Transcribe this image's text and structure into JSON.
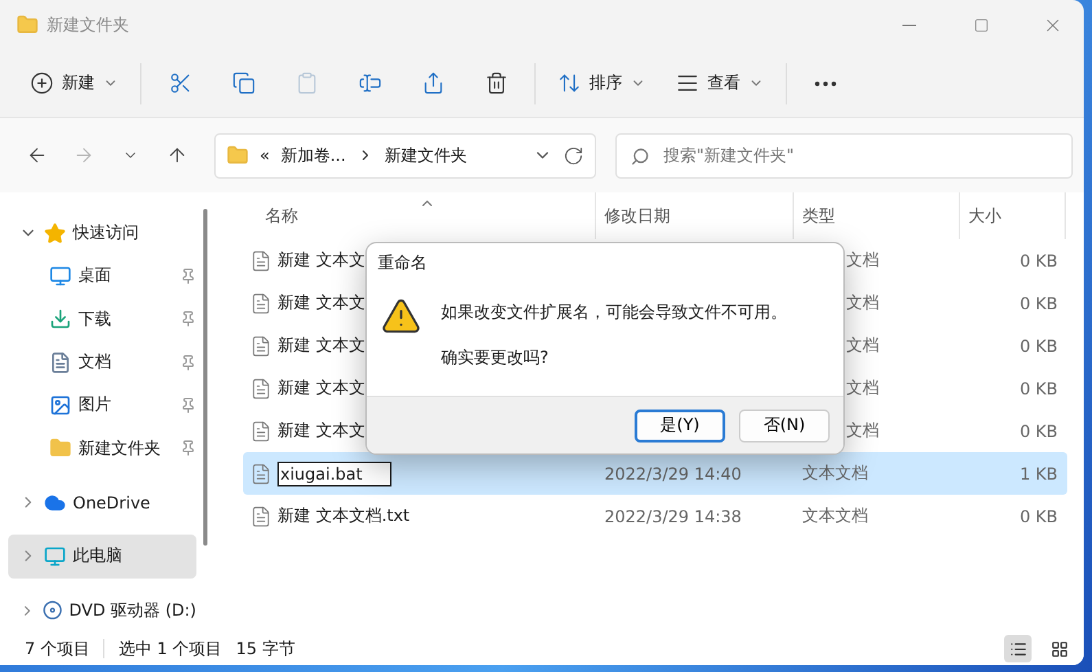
{
  "window": {
    "title": "新建文件夹"
  },
  "toolbar": [
    {
      "kind": "new",
      "label": "新建",
      "dropdown": true,
      "disabled": false
    },
    {
      "kind": "cut",
      "disabled": false
    },
    {
      "kind": "copy",
      "disabled": false
    },
    {
      "kind": "paste",
      "disabled": true
    },
    {
      "kind": "rename",
      "disabled": false
    },
    {
      "kind": "share",
      "disabled": false
    },
    {
      "kind": "delete",
      "disabled": false
    },
    {
      "kind": "sort",
      "label": "排序",
      "dropdown": true,
      "disabled": false
    },
    {
      "kind": "view",
      "label": "查看",
      "dropdown": true,
      "disabled": false
    },
    {
      "kind": "more",
      "disabled": false
    }
  ],
  "navigation": [
    {
      "kind": "back",
      "disabled": false
    },
    {
      "kind": "forward",
      "disabled": true
    },
    {
      "kind": "recent",
      "disabled": false
    },
    {
      "kind": "up",
      "disabled": false
    }
  ],
  "address": {
    "overflow": "«",
    "segments": [
      "新加卷...",
      "新建文件夹"
    ]
  },
  "search": {
    "placeholder": "搜索\"新建文件夹\""
  },
  "sidebar": {
    "items": [
      {
        "label": "快速访问",
        "kind": "star",
        "expanded": true,
        "selected": false,
        "children": [
          {
            "label": "桌面",
            "kind": "desktop",
            "pinned": true,
            "selected": false
          },
          {
            "label": "下载",
            "kind": "download",
            "pinned": true,
            "selected": false
          },
          {
            "label": "文档",
            "kind": "documents",
            "pinned": true,
            "selected": false
          },
          {
            "label": "图片",
            "kind": "pictures",
            "pinned": true,
            "selected": false
          },
          {
            "label": "新建文件夹",
            "kind": "folder",
            "pinned": true,
            "selected": false
          }
        ]
      },
      {
        "label": "OneDrive",
        "kind": "cloud",
        "expanded": false,
        "selected": false
      },
      {
        "label": "此电脑",
        "kind": "pc",
        "expanded": false,
        "selected": true
      },
      {
        "label": "DVD 驱动器 (D:)",
        "kind": "dvd",
        "expanded": false,
        "selected": false
      }
    ]
  },
  "table": {
    "columns": [
      {
        "label": "名称",
        "sorted": true
      },
      {
        "label": "修改日期",
        "sorted": false
      },
      {
        "label": "类型",
        "sorted": false
      },
      {
        "label": "大小",
        "sorted": false
      }
    ],
    "rows": [
      {
        "name": "新建 文本文",
        "type": "文档",
        "size": "0 KB",
        "selected": false,
        "editing": false
      },
      {
        "name": "新建 文本文",
        "type": "文档",
        "size": "0 KB",
        "selected": false,
        "editing": false
      },
      {
        "name": "新建 文本文",
        "type": "文档",
        "size": "0 KB",
        "selected": false,
        "editing": false
      },
      {
        "name": "新建 文本文",
        "type": "文档",
        "size": "0 KB",
        "selected": false,
        "editing": false
      },
      {
        "name": "新建 文本文",
        "type": "文档",
        "size": "0 KB",
        "selected": false,
        "editing": false
      },
      {
        "name": "xiugai.bat",
        "date": "2022/3/29 14:40",
        "type": "文本文档",
        "size": "1 KB",
        "selected": true,
        "editing": true
      },
      {
        "name": "新建 文本文档.txt",
        "date": "2022/3/29 14:38",
        "type": "文本文档",
        "size": "0 KB",
        "selected": false,
        "editing": false
      }
    ]
  },
  "status_bar": {
    "count": "7 个项目",
    "selection": "选中 1 个项目",
    "bytes": "15 字节",
    "views": [
      {
        "kind": "details",
        "selected": true
      },
      {
        "kind": "tiles",
        "selected": false
      }
    ]
  },
  "dialog": {
    "title": "重命名",
    "message": "如果改变文件扩展名，可能会导致文件不可用。",
    "question": "确实要更改吗?",
    "buttons": [
      {
        "label": "是(Y)",
        "default": true
      },
      {
        "label": "否(N)",
        "default": false
      }
    ]
  }
}
